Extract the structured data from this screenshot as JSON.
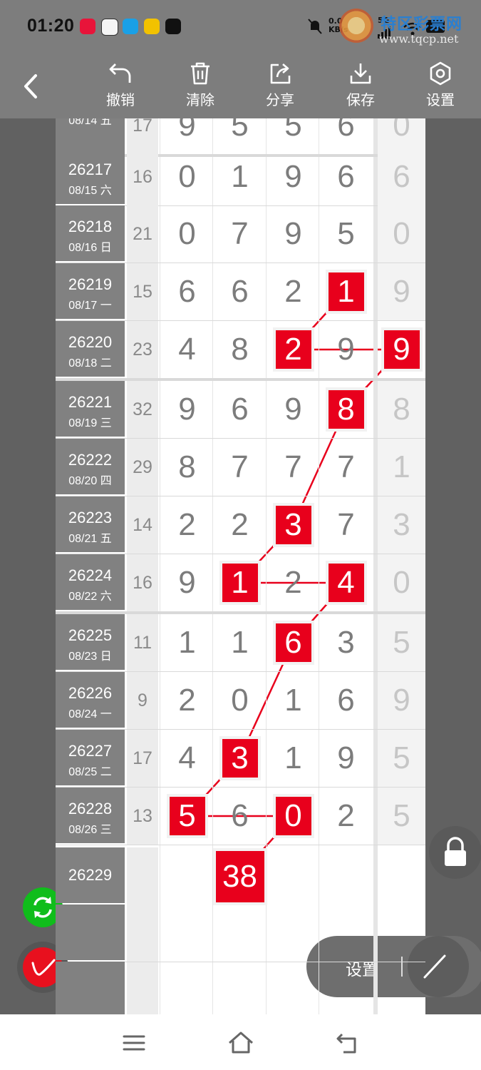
{
  "status_bar": {
    "time": "01:20",
    "net_speed_top": "0.0",
    "net_speed_unit": "KB/s",
    "network": "5G",
    "app_icons": [
      "app-icon-red",
      "app-icon-avatar",
      "app-icon-blue",
      "app-icon-yellow",
      "tiktok-icon"
    ]
  },
  "watermark": {
    "title": "特区彩票网",
    "url": "www.tqcp.net"
  },
  "toolbar": {
    "undo_label": "撤销",
    "clear_label": "清除",
    "share_label": "分享",
    "save_label": "保存",
    "settings_label": "设置"
  },
  "rows": [
    {
      "issue": "",
      "date": "08/14 五",
      "sum": "17",
      "digits": [
        "9",
        "5",
        "5",
        "6"
      ],
      "tail": "0",
      "hits": []
    },
    {
      "issue": "26217",
      "date": "08/15 六",
      "sum": "16",
      "digits": [
        "0",
        "1",
        "9",
        "6"
      ],
      "tail": "6",
      "hits": []
    },
    {
      "issue": "26218",
      "date": "08/16 日",
      "sum": "21",
      "digits": [
        "0",
        "7",
        "9",
        "5"
      ],
      "tail": "0",
      "hits": []
    },
    {
      "issue": "26219",
      "date": "08/17 一",
      "sum": "15",
      "digits": [
        "6",
        "6",
        "2",
        "1"
      ],
      "tail": "9",
      "hits": [
        3
      ]
    },
    {
      "issue": "26220",
      "date": "08/18 二",
      "sum": "23",
      "digits": [
        "4",
        "8",
        "2",
        "9"
      ],
      "tail": "9",
      "hits": [
        2,
        4
      ]
    },
    {
      "issue": "26221",
      "date": "08/19 三",
      "sum": "32",
      "digits": [
        "9",
        "6",
        "9",
        "8"
      ],
      "tail": "8",
      "hits": [
        3
      ]
    },
    {
      "issue": "26222",
      "date": "08/20 四",
      "sum": "29",
      "digits": [
        "8",
        "7",
        "7",
        "7"
      ],
      "tail": "1",
      "hits": []
    },
    {
      "issue": "26223",
      "date": "08/21 五",
      "sum": "14",
      "digits": [
        "2",
        "2",
        "3",
        "7"
      ],
      "tail": "3",
      "hits": [
        2
      ]
    },
    {
      "issue": "26224",
      "date": "08/22 六",
      "sum": "16",
      "digits": [
        "9",
        "1",
        "2",
        "4"
      ],
      "tail": "0",
      "hits": [
        1,
        3
      ]
    },
    {
      "issue": "26225",
      "date": "08/23 日",
      "sum": "11",
      "digits": [
        "1",
        "1",
        "6",
        "3"
      ],
      "tail": "5",
      "hits": [
        2
      ]
    },
    {
      "issue": "26226",
      "date": "08/24 一",
      "sum": "9",
      "digits": [
        "2",
        "0",
        "1",
        "6"
      ],
      "tail": "9",
      "hits": []
    },
    {
      "issue": "26227",
      "date": "08/25 二",
      "sum": "17",
      "digits": [
        "4",
        "3",
        "1",
        "9"
      ],
      "tail": "5",
      "hits": [
        1
      ]
    },
    {
      "issue": "26228",
      "date": "08/26 三",
      "sum": "13",
      "digits": [
        "5",
        "6",
        "0",
        "2"
      ],
      "tail": "5",
      "hits": [
        0,
        2
      ]
    }
  ],
  "next_row": {
    "issue": "26229",
    "prediction": "38"
  },
  "settings_pill": {
    "label": "设置"
  },
  "colors": {
    "hit": "#e8001c",
    "toolbar": "#7d7d7d",
    "issue_bg": "#818181",
    "refresh": "#10bd1b",
    "pen": "#e8101e"
  }
}
